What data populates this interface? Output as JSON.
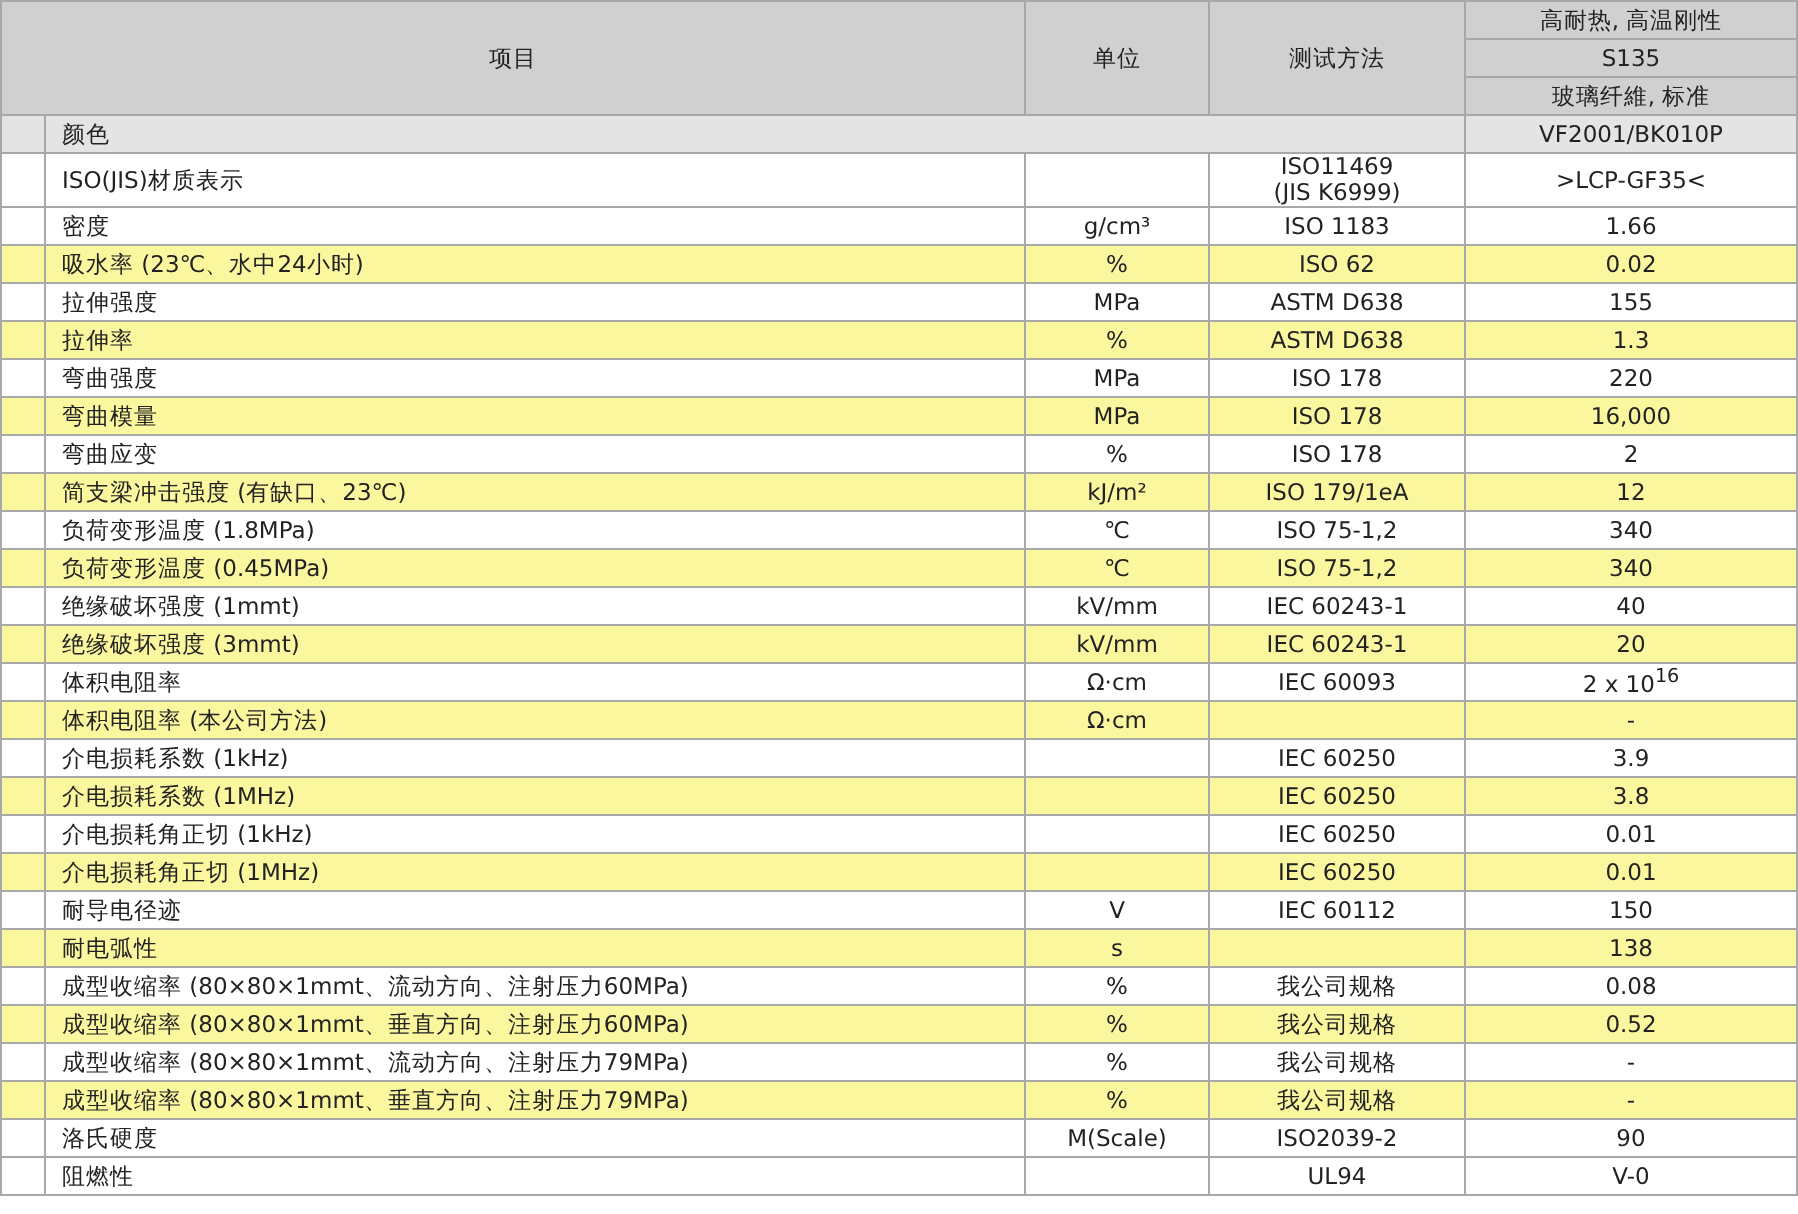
{
  "table": {
    "columns": [
      {
        "label": "项目"
      },
      {
        "label": "单位"
      },
      {
        "label": "测试方法"
      }
    ],
    "value_header": [
      "高耐热, 高温刚性",
      "S135",
      "玻璃纤維, 标准"
    ],
    "color_row": {
      "item": "颜色",
      "value": "VF2001/BK010P"
    },
    "rows": [
      {
        "item": "ISO(JIS)材质表示",
        "unit": "",
        "method": "ISO11469\n(JIS K6999)",
        "value": ">LCP-GF35<",
        "highlight": false
      },
      {
        "item": "密度",
        "unit": "g/cm³",
        "method": "ISO 1183",
        "value": "1.66",
        "highlight": false
      },
      {
        "item": "吸水率 (23℃、水中24小时)",
        "unit": "%",
        "method": "ISO 62",
        "value": "0.02",
        "highlight": true
      },
      {
        "item": "拉伸强度",
        "unit": "MPa",
        "method": "ASTM D638",
        "value": "155",
        "highlight": false
      },
      {
        "item": "拉伸率",
        "unit": "%",
        "method": "ASTM D638",
        "value": "1.3",
        "highlight": true
      },
      {
        "item": "弯曲强度",
        "unit": "MPa",
        "method": "ISO 178",
        "value": "220",
        "highlight": false
      },
      {
        "item": "弯曲模量",
        "unit": "MPa",
        "method": "ISO 178",
        "value": "16,000",
        "highlight": true
      },
      {
        "item": "弯曲应变",
        "unit": "%",
        "method": "ISO 178",
        "value": "2",
        "highlight": false
      },
      {
        "item": "简支梁冲击强度 (有缺口、23℃)",
        "unit": "kJ/m²",
        "method": "ISO 179/1eA",
        "value": "12",
        "highlight": true
      },
      {
        "item": "负荷变形温度 (1.8MPa)",
        "unit": "℃",
        "method": "ISO 75-1,2",
        "value": "340",
        "highlight": false
      },
      {
        "item": "负荷变形温度 (0.45MPa)",
        "unit": "℃",
        "method": "ISO 75-1,2",
        "value": "340",
        "highlight": true
      },
      {
        "item": "绝缘破坏强度 (1mmt)",
        "unit": "kV/mm",
        "method": "IEC 60243-1",
        "value": "40",
        "highlight": false
      },
      {
        "item": "绝缘破坏强度 (3mmt)",
        "unit": "kV/mm",
        "method": "IEC 60243-1",
        "value": "20",
        "highlight": true
      },
      {
        "item": "体积电阻率",
        "unit": "Ω·cm",
        "method": "IEC 60093",
        "value": "2 x 10$^{16}$",
        "highlight": false
      },
      {
        "item": "体积电阻率 (本公司方法)",
        "unit": "Ω·cm",
        "method": "",
        "value": "-",
        "highlight": true
      },
      {
        "item": "介电损耗系数 (1kHz)",
        "unit": "",
        "method": "IEC 60250",
        "value": "3.9",
        "highlight": false
      },
      {
        "item": "介电损耗系数 (1MHz)",
        "unit": "",
        "method": "IEC 60250",
        "value": "3.8",
        "highlight": true
      },
      {
        "item": "介电损耗角正切 (1kHz)",
        "unit": "",
        "method": "IEC 60250",
        "value": "0.01",
        "highlight": false
      },
      {
        "item": "介电损耗角正切 (1MHz)",
        "unit": "",
        "method": "IEC 60250",
        "value": "0.01",
        "highlight": true
      },
      {
        "item": "耐导电径迹",
        "unit": "V",
        "method": "IEC 60112",
        "value": "150",
        "highlight": false
      },
      {
        "item": "耐电弧性",
        "unit": "s",
        "method": "",
        "value": "138",
        "highlight": true
      },
      {
        "item": "成型收缩率 (80×80×1mmt、流动方向、注射压力60MPa)",
        "unit": "%",
        "method": "我公司规格",
        "value": "0.08",
        "highlight": false
      },
      {
        "item": "成型收缩率 (80×80×1mmt、垂直方向、注射压力60MPa)",
        "unit": "%",
        "method": "我公司规格",
        "value": "0.52",
        "highlight": true
      },
      {
        "item": "成型收缩率 (80×80×1mmt、流动方向、注射压力79MPa)",
        "unit": "%",
        "method": "我公司规格",
        "value": "-",
        "highlight": false
      },
      {
        "item": "成型收缩率 (80×80×1mmt、垂直方向、注射压力79MPa)",
        "unit": "%",
        "method": "我公司规格",
        "value": "-",
        "highlight": true
      },
      {
        "item": "洛氏硬度",
        "unit": "M(Scale)",
        "method": "ISO2039-2",
        "value": "90",
        "highlight": false
      },
      {
        "item": "阻燃性",
        "unit": "",
        "method": "UL94",
        "value": "V-0",
        "highlight": false
      }
    ]
  }
}
